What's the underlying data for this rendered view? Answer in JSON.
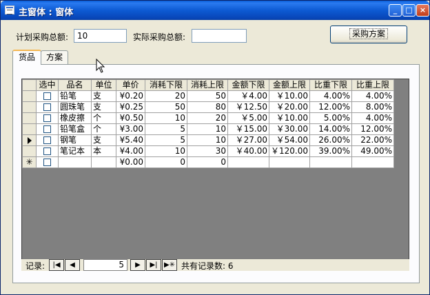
{
  "window": {
    "title": "主窗体 : 窗体",
    "minimize_glyph": "_",
    "maximize_glyph": "□",
    "close_glyph": "×"
  },
  "form": {
    "planned_total_label": "计划采购总额:",
    "planned_total_value": "10",
    "actual_total_label": "实际采购总额:",
    "actual_total_value": "",
    "plan_button_label": "采购方案"
  },
  "tabs": [
    {
      "label": "货品",
      "active": true
    },
    {
      "label": "方案",
      "active": false
    }
  ],
  "grid": {
    "columns": [
      "选中",
      "品名",
      "单位",
      "单价",
      "消耗下限",
      "消耗上限",
      "金额下限",
      "金额上限",
      "比重下限",
      "比重上限"
    ],
    "rows": [
      {
        "indicator": "",
        "name": "铅笔",
        "unit": "支",
        "price": "¥0.20",
        "use_min": "20",
        "use_max": "50",
        "amt_min": "￥4.00",
        "amt_max": "￥10.00",
        "ratio_min": "4.00%",
        "ratio_max": "4.00%"
      },
      {
        "indicator": "",
        "name": "圆珠笔",
        "unit": "支",
        "price": "¥0.25",
        "use_min": "50",
        "use_max": "80",
        "amt_min": "￥12.50",
        "amt_max": "￥20.00",
        "ratio_min": "12.00%",
        "ratio_max": "8.00%"
      },
      {
        "indicator": "",
        "name": "橡皮擦",
        "unit": "个",
        "price": "¥0.50",
        "use_min": "10",
        "use_max": "20",
        "amt_min": "￥5.00",
        "amt_max": "￥10.00",
        "ratio_min": "5.00%",
        "ratio_max": "4.00%"
      },
      {
        "indicator": "",
        "name": "铅笔盒",
        "unit": "个",
        "price": "¥3.00",
        "use_min": "5",
        "use_max": "10",
        "amt_min": "￥15.00",
        "amt_max": "￥30.00",
        "ratio_min": "14.00%",
        "ratio_max": "12.00%"
      },
      {
        "indicator": "current",
        "name": "钢笔",
        "unit": "支",
        "price": "¥5.40",
        "use_min": "5",
        "use_max": "10",
        "amt_min": "￥27.00",
        "amt_max": "￥54.00",
        "ratio_min": "26.00%",
        "ratio_max": "22.00%"
      },
      {
        "indicator": "",
        "name": "笔记本",
        "unit": "本",
        "price": "¥4.00",
        "use_min": "10",
        "use_max": "30",
        "amt_min": "￥40.00",
        "amt_max": "￥120.00",
        "ratio_min": "39.00%",
        "ratio_max": "49.00%"
      }
    ],
    "new_row": {
      "indicator_glyph": "✳",
      "price": "¥0.00",
      "use_min": "0",
      "use_max": "0"
    }
  },
  "navigator": {
    "label": "记录:",
    "current_record": "5",
    "total_text": "共有记录数: 6",
    "first_glyph": "|◀",
    "prev_glyph": "◀",
    "next_glyph": "▶",
    "last_glyph": "▶|",
    "new_glyph": "▶✳"
  },
  "icons": {
    "app_icon": "form-window-icon",
    "cursor": "mouse-pointer-icon"
  }
}
